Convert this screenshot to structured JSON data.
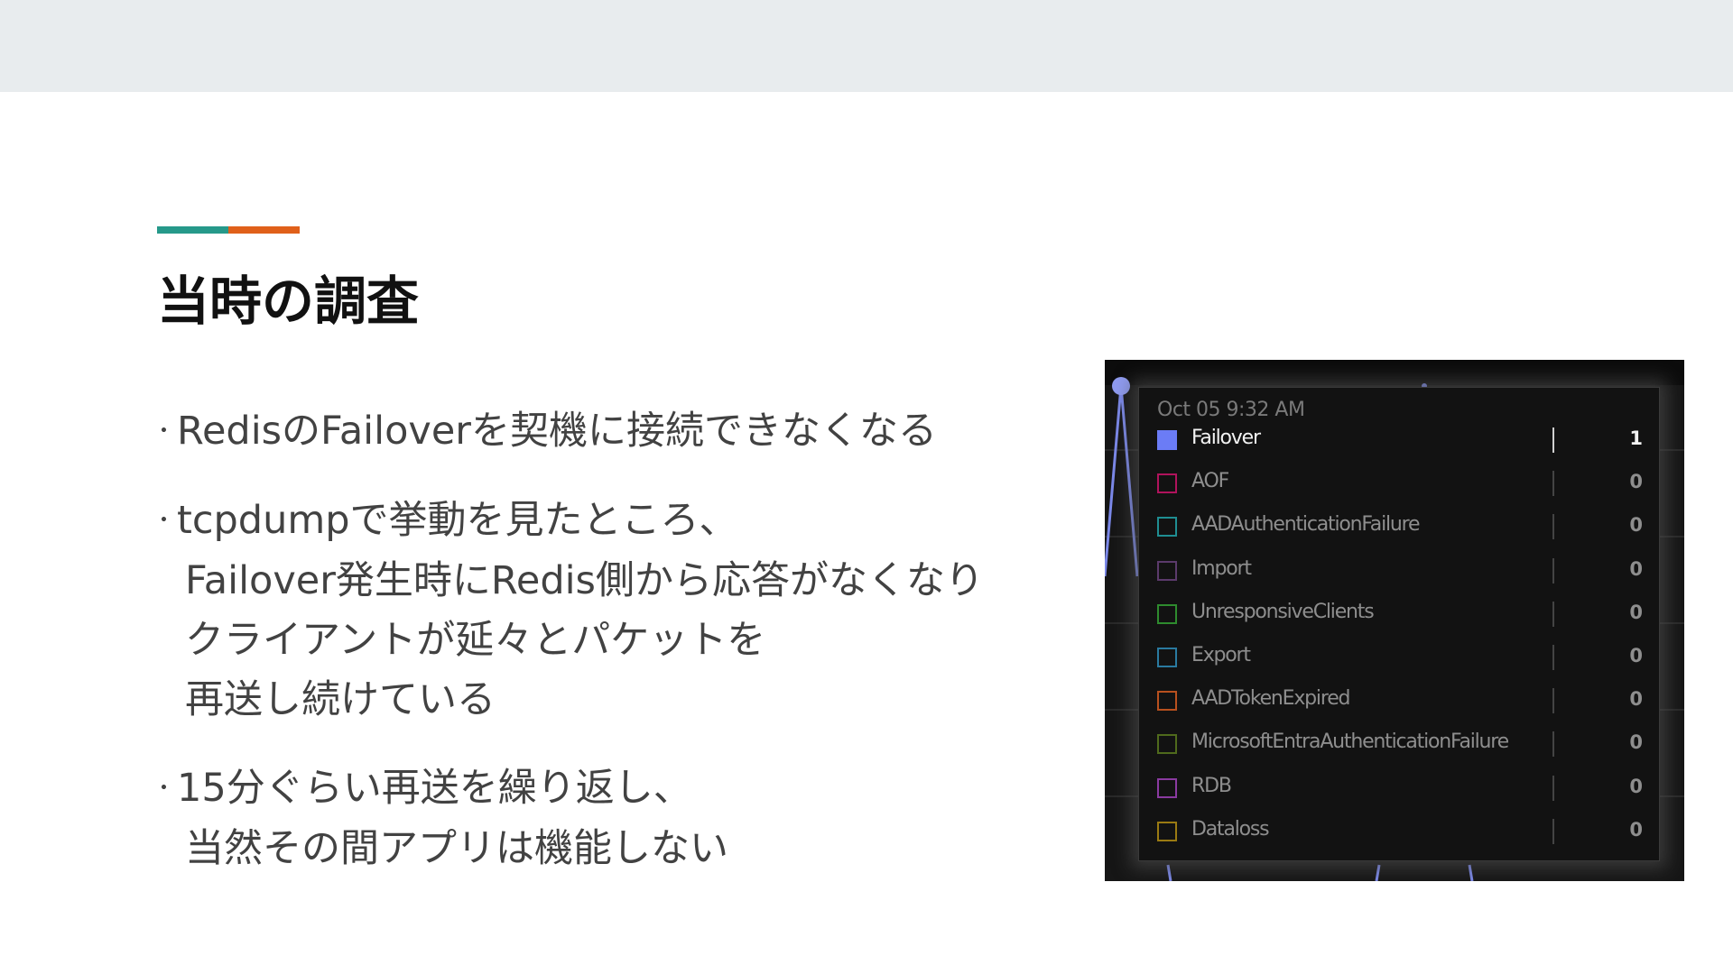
{
  "colors": {
    "accent_teal": "#26998a",
    "accent_orange": "#e0601a",
    "top_band": "#e8ecee",
    "chart_line": "#7b88e8"
  },
  "slide": {
    "title": "当時の調査",
    "bullet_marker": "･",
    "bullets": [
      {
        "lines": [
          "RedisのFailoverを契機に接続できなくなる"
        ]
      },
      {
        "lines": [
          "tcpdumpで挙動を見たところ、",
          "Failover発生時にRedis側から応答がなくなり",
          "クライアントが延々とパケットを",
          "再送し続けている"
        ]
      },
      {
        "lines": [
          "15分ぐらい再送を繰り返し、",
          "当然その間アプリは機能しない"
        ]
      }
    ]
  },
  "tooltip": {
    "timestamp": "Oct 05 9:32 AM",
    "rows": [
      {
        "label": "Failover",
        "value": "1",
        "color": "#6b7cf6",
        "filled": true
      },
      {
        "label": "AOF",
        "value": "0",
        "color": "#b0135c",
        "filled": false
      },
      {
        "label": "AADAuthenticationFailure",
        "value": "0",
        "color": "#1f8e92",
        "filled": false
      },
      {
        "label": "Import",
        "value": "0",
        "color": "#5b3a6b",
        "filled": false
      },
      {
        "label": "UnresponsiveClients",
        "value": "0",
        "color": "#2e8b2e",
        "filled": false
      },
      {
        "label": "Export",
        "value": "0",
        "color": "#2a7aa0",
        "filled": false
      },
      {
        "label": "AADTokenExpired",
        "value": "0",
        "color": "#b8501e",
        "filled": false
      },
      {
        "label": "MicrosoftEntraAuthenticationFailure",
        "value": "0",
        "color": "#4f6a1c",
        "filled": false
      },
      {
        "label": "RDB",
        "value": "0",
        "color": "#8a3aa0",
        "filled": false
      },
      {
        "label": "Dataloss",
        "value": "0",
        "color": "#9a7a12",
        "filled": false
      }
    ]
  }
}
